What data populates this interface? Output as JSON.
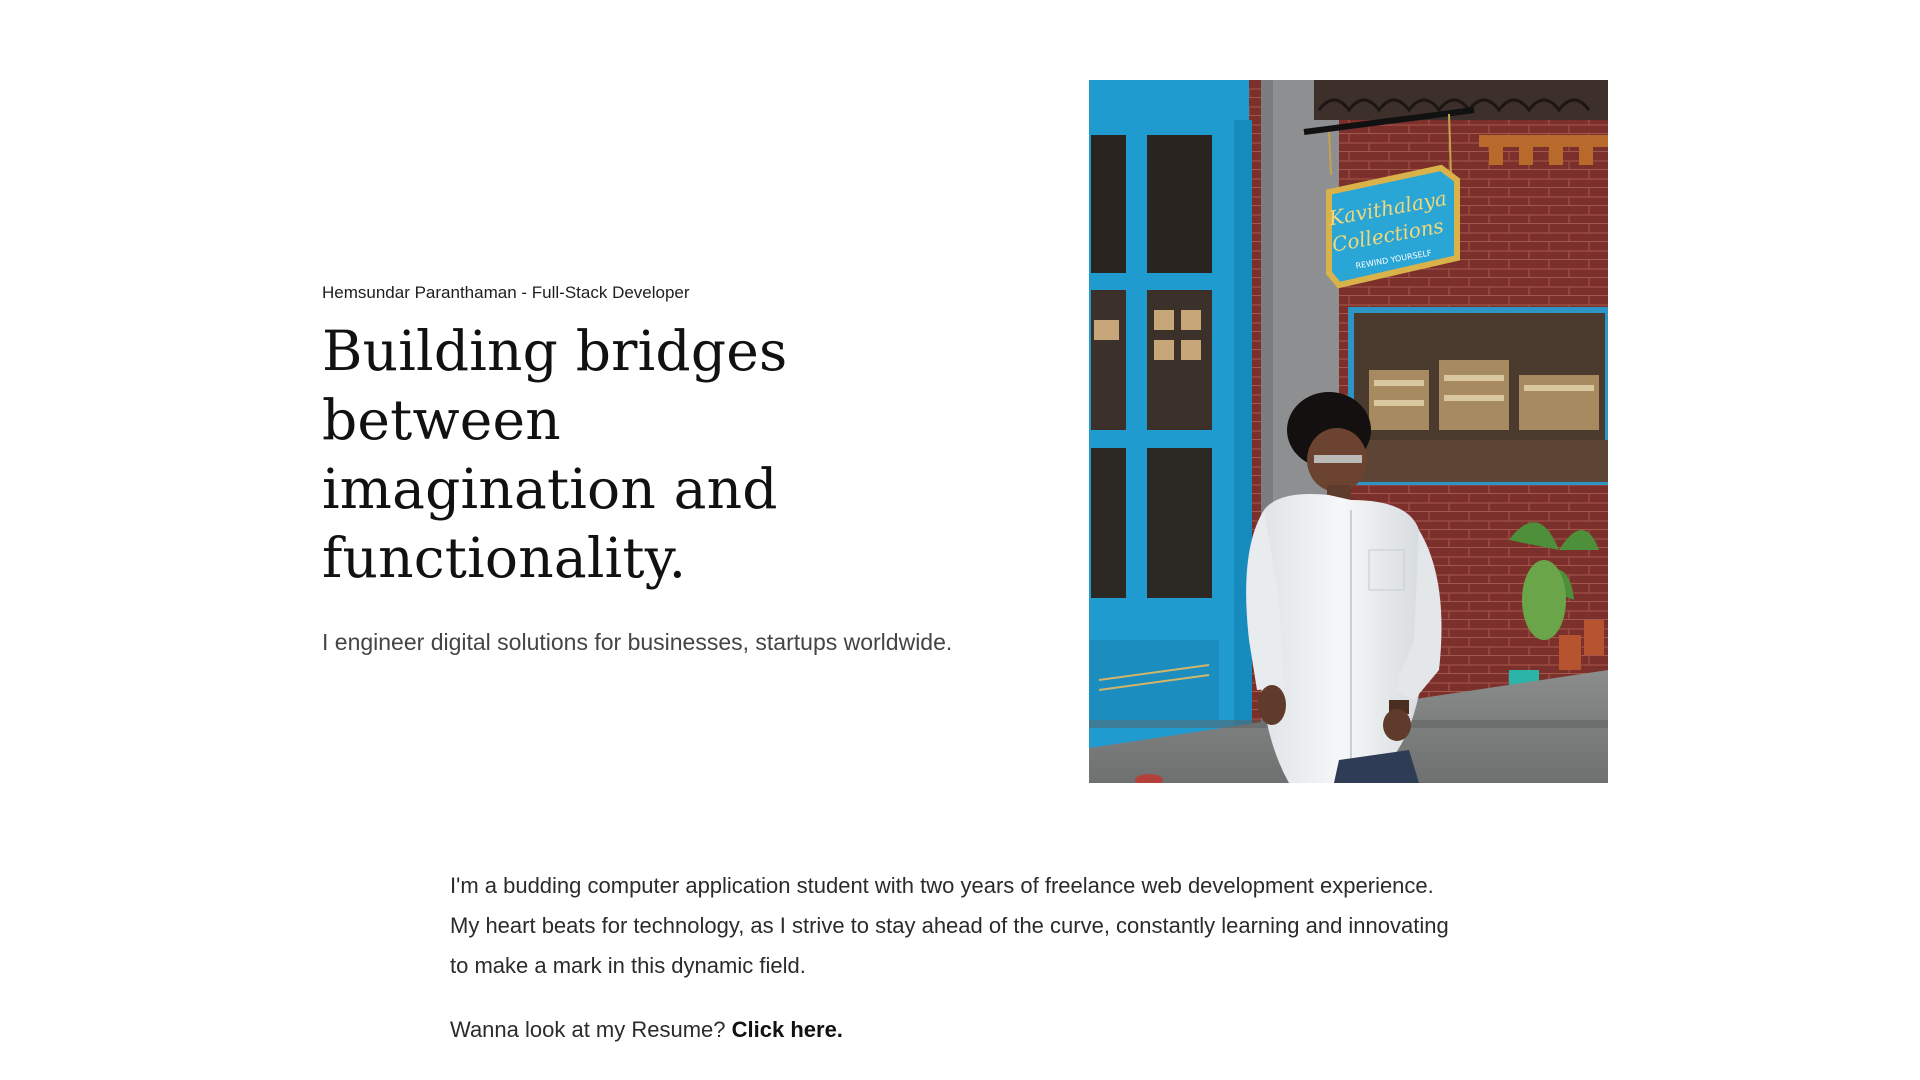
{
  "hero": {
    "eyebrow": "Hemsundar Paranthaman - Full-Stack Developer",
    "headline_line1": "Building bridges between",
    "headline_line2": "imagination and",
    "headline_line3": "functionality.",
    "tagline": "I engineer digital solutions for businesses, startups worldwide."
  },
  "photo": {
    "sign_line1": "Kavithalaya",
    "sign_line2": "Collections",
    "sign_line3": "REWIND YOURSELF"
  },
  "about": {
    "paragraph": "I'm a budding computer application student with two years of freelance web development experience. My heart beats for technology, as I strive to stay ahead of the curve, constantly learning and innovating to make a mark in this dynamic field.",
    "resume_prompt": "Wanna look at my Resume? ",
    "resume_link": "Click here."
  },
  "colors": {
    "door_blue": "#1f9bd0",
    "brick": "#7a2f2a",
    "shirt": "#f2f4f5"
  }
}
